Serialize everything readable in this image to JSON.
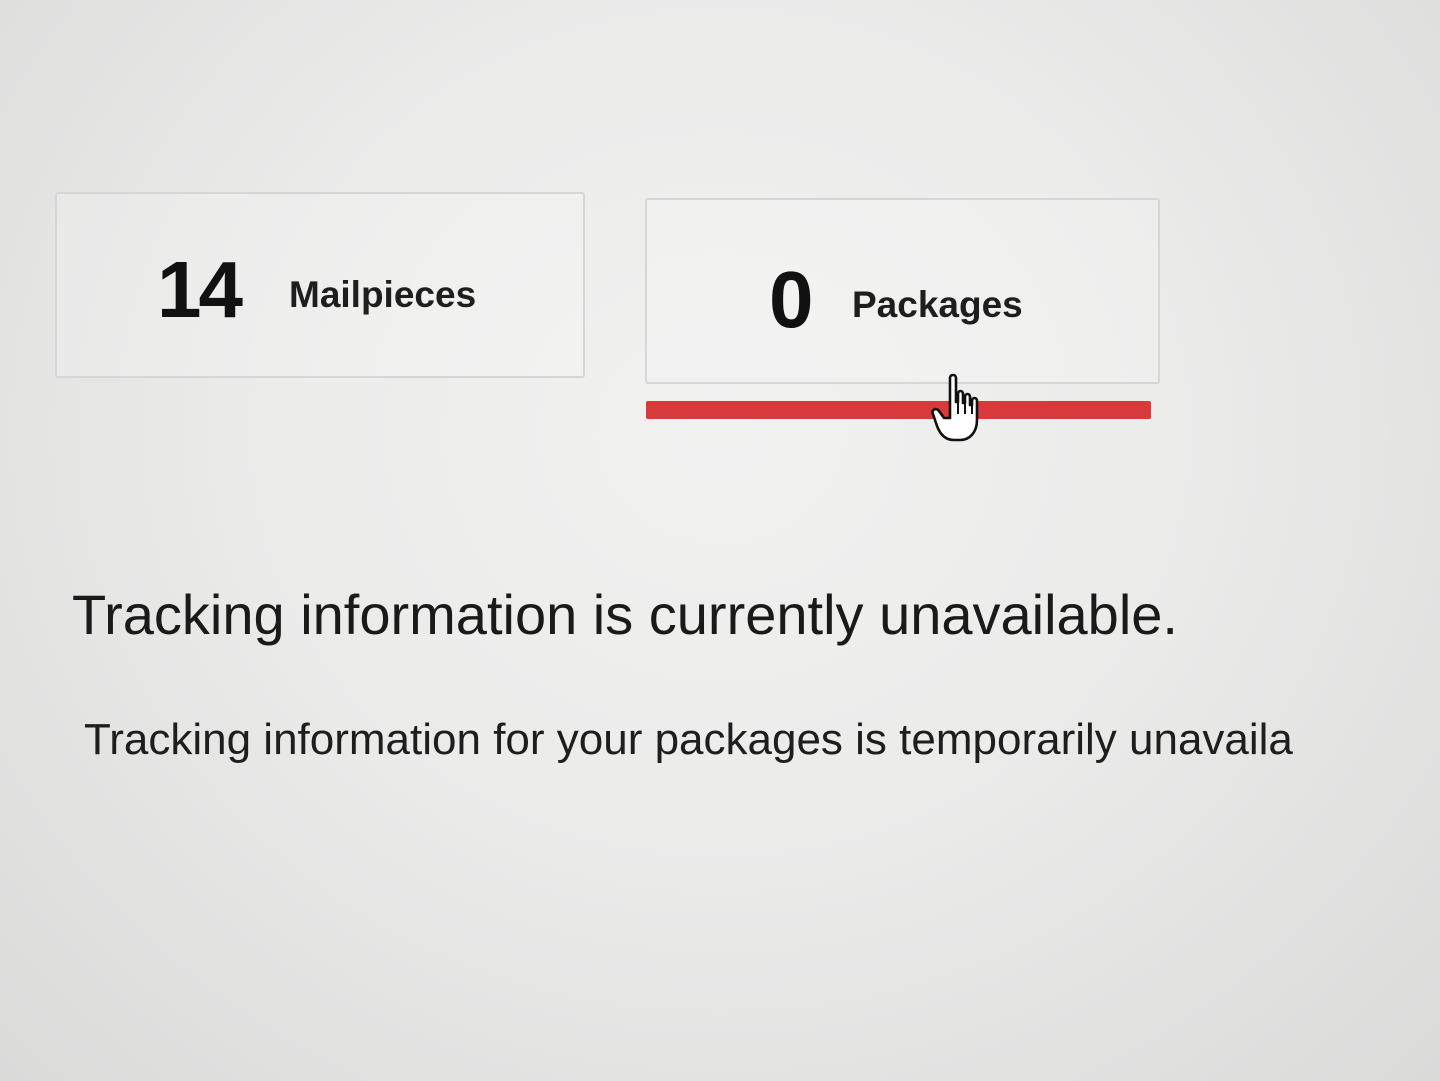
{
  "tabs": [
    {
      "count": "14",
      "label": "Mailpieces"
    },
    {
      "count": "0",
      "label": "Packages"
    }
  ],
  "active_tab": "Packages",
  "accent_color": "#d63a3a",
  "message": {
    "title": "Tracking information is currently unavailable.",
    "body": "Tracking information for your packages is temporarily unavaila"
  },
  "cursor": "hand-pointer-icon"
}
